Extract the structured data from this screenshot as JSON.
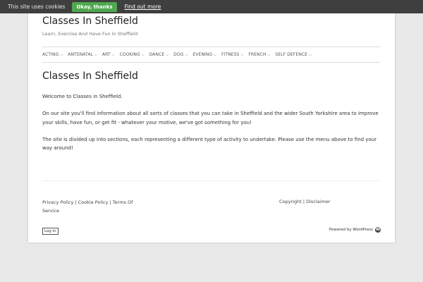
{
  "cookie_bar": {
    "message": "This site uses cookies",
    "ok_label": "Okay, thanks",
    "more_label": "Find out more"
  },
  "header": {
    "title": "Classes In Sheffield",
    "tagline": "Learn, Exercise And Have Fun In Sheffield"
  },
  "nav": {
    "items": [
      {
        "label": "Acting"
      },
      {
        "label": "Antenatal"
      },
      {
        "label": "Art"
      },
      {
        "label": "Cooking"
      },
      {
        "label": "Dance"
      },
      {
        "label": "Dog"
      },
      {
        "label": "Evening"
      },
      {
        "label": "Fitness"
      },
      {
        "label": "French"
      },
      {
        "label": "Self Defence"
      }
    ]
  },
  "main": {
    "title": "Classes In Sheffield",
    "paragraphs": [
      "Welcome to Classes in Sheffield.",
      "On our site you'll find information about all sorts of classes that you can take in Sheffield and the wider South Yorkshire area to improve your skills, have fun, or get fit - whatever your motive, we've got something for you!",
      "The site is divided up into sections, each representing a different type of activity to undertake. Please use the menu above to find your way around!"
    ]
  },
  "footer": {
    "left_links": [
      "Privacy Policy",
      "Cookie Policy",
      "Terms Of Service"
    ],
    "right_links": [
      "Copyright",
      "Disclaimer"
    ],
    "login_label": "Log in",
    "powered_label": "Powered by WordPress"
  },
  "colors": {
    "cookie_bar_bg": "#3f3f3f",
    "ok_button_bg": "#4ea84e",
    "page_bg": "#e9e9e9"
  }
}
